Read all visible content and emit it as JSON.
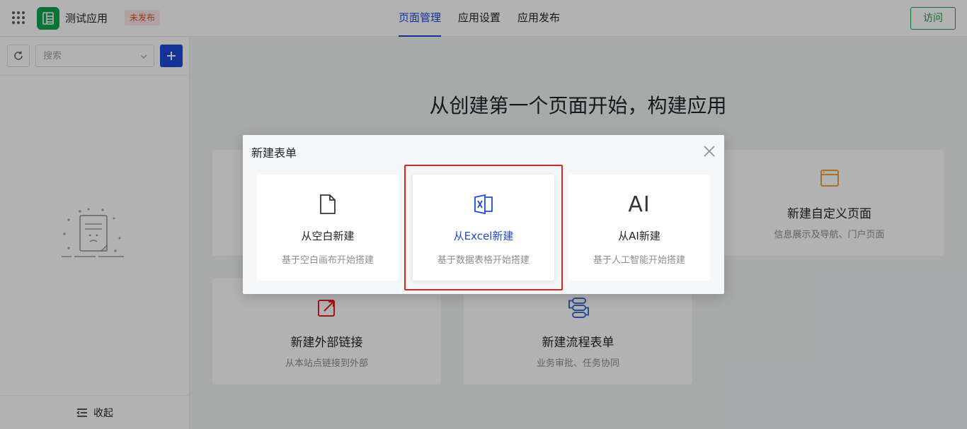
{
  "header": {
    "app_name": "测试应用",
    "status_badge": "未发布",
    "nav": [
      {
        "label": "页面管理",
        "active": true
      },
      {
        "label": "应用设置",
        "active": false
      },
      {
        "label": "应用发布",
        "active": false
      }
    ],
    "visit_label": "访问"
  },
  "sidebar": {
    "search_placeholder": "搜索",
    "collapse_label": "收起"
  },
  "main": {
    "title": "从创建第一个页面开始，构建应用",
    "cards": [
      {
        "title": "新建自定义页面",
        "subtitle": "信息展示及导航、门户页面",
        "icon": "window-icon"
      },
      {
        "title": "新建外部链接",
        "subtitle": "从本站点链接到外部",
        "icon": "external-link-icon"
      },
      {
        "title": "新建流程表单",
        "subtitle": "业务审批、任务协同",
        "icon": "workflow-icon"
      }
    ]
  },
  "modal": {
    "title": "新建表单",
    "options": [
      {
        "title": "从空白新建",
        "subtitle": "基于空白画布开始搭建",
        "icon": "blank-document-icon"
      },
      {
        "title": "从Excel新建",
        "subtitle": "基于数据表格开始搭建",
        "icon": "excel-icon",
        "selected": true
      },
      {
        "title": "从AI新建",
        "subtitle": "基于人工智能开始搭建",
        "icon": "ai-icon",
        "icon_text": "AI"
      }
    ]
  },
  "colors": {
    "primary": "#1f49d8",
    "green": "#13a450",
    "badge_red": "#d9503c",
    "highlight_red": "#e0231f",
    "orange": "#e8a33d"
  }
}
